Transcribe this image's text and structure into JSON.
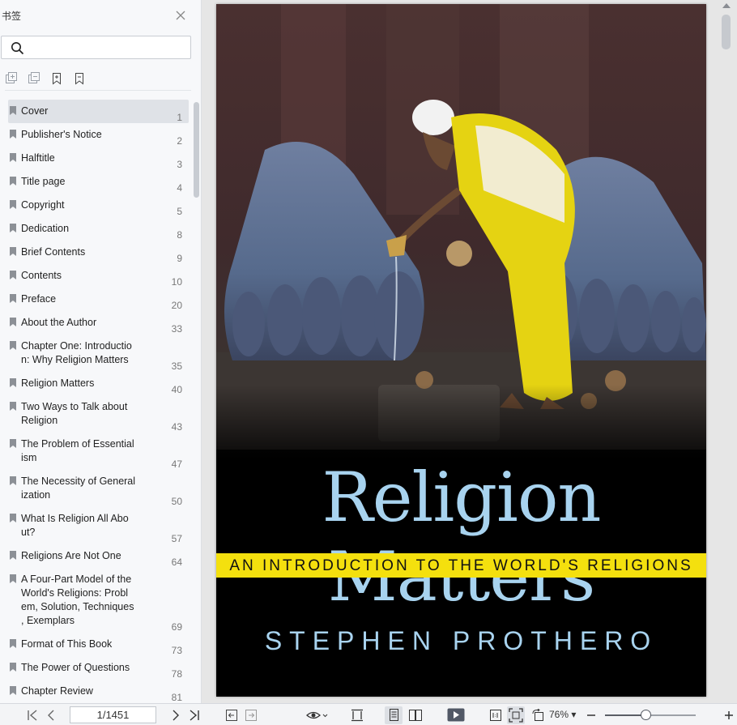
{
  "sidebar": {
    "title": "书签",
    "search_placeholder": "",
    "bookmarks": [
      {
        "label": "Cover",
        "page": "1",
        "selected": true
      },
      {
        "label": "Publisher's Notice",
        "page": "2"
      },
      {
        "label": "Halftitle",
        "page": "3"
      },
      {
        "label": "Title page",
        "page": "4"
      },
      {
        "label": "Copyright",
        "page": "5"
      },
      {
        "label": "Dedication",
        "page": "8"
      },
      {
        "label": "Brief Contents",
        "page": "9"
      },
      {
        "label": "Contents",
        "page": "10"
      },
      {
        "label": "Preface",
        "page": "20"
      },
      {
        "label": "About the Author",
        "page": "33"
      },
      {
        "label": "Chapter One: Introductio\nn: Why Religion Matters",
        "page": "35"
      },
      {
        "label": "Religion Matters",
        "page": "40"
      },
      {
        "label": "Two Ways to Talk about\nReligion",
        "page": "43"
      },
      {
        "label": "The Problem of Essential\nism",
        "page": "47"
      },
      {
        "label": "The Necessity of General\nization",
        "page": "50"
      },
      {
        "label": "What Is Religion All Abo\nut?",
        "page": "57"
      },
      {
        "label": "Religions Are Not One",
        "page": "64"
      },
      {
        "label": "A Four-Part Model of the\nWorld's Religions: Probl\nem, Solution, Techniques\n, Exemplars",
        "page": "69"
      },
      {
        "label": "Format of This Book",
        "page": "73"
      },
      {
        "label": "The Power of Questions",
        "page": "78"
      },
      {
        "label": "Chapter Review",
        "page": "81"
      }
    ]
  },
  "cover": {
    "title": "Religion Matters",
    "subtitle": "AN INTRODUCTION TO THE WORLD'S RELIGIONS",
    "author": "STEPHEN PROTHERO"
  },
  "toolbar": {
    "page_indicator": "1/1451",
    "zoom": "76%",
    "zoom_fraction": 0.45
  },
  "colors": {
    "cover_title": "#a8d3ef",
    "subtitle_band": "#f4e00e",
    "sidebar_bg": "#f7f8fa",
    "selected_row": "#dfe2e7"
  }
}
